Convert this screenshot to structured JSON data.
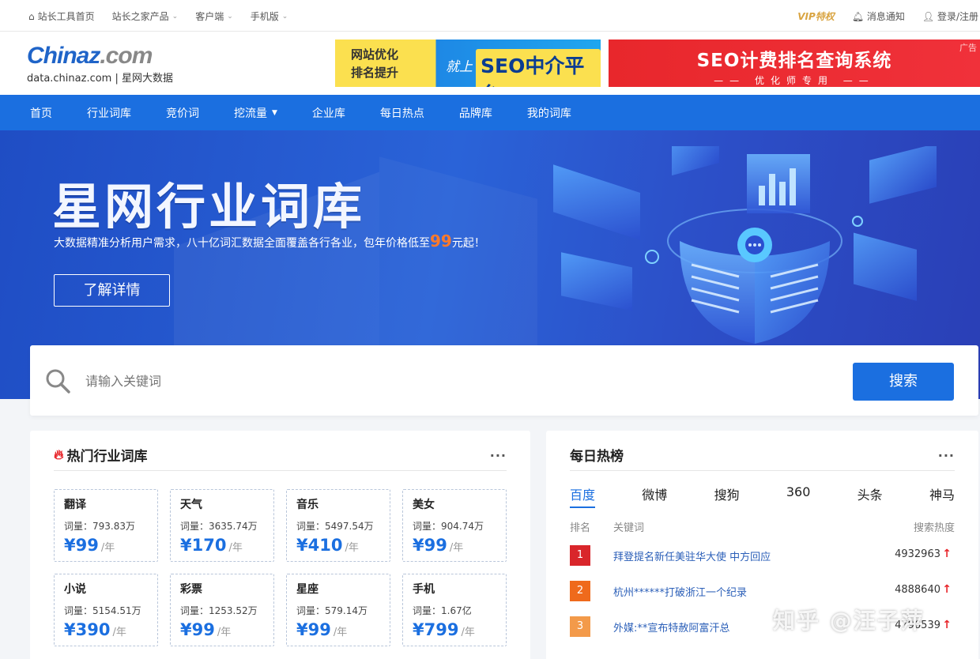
{
  "topbar": {
    "home": "站长工具首页",
    "products": "站长之家产品",
    "client": "客户端",
    "mobile": "手机版",
    "vip": "VIP特权",
    "notice": "消息通知",
    "login": "登录/注册"
  },
  "logo": {
    "brand_a": "Chinaz",
    "brand_b": ".com",
    "domain": "data.chinaz.com",
    "slogan": "星网大数据"
  },
  "ads": {
    "left_line1": "网站优化",
    "left_line2": "排名提升",
    "left_mid": "就上",
    "left_big": "SEO中介平台",
    "right_title": "SEO计费排名查询系统",
    "right_sub": "—— 优化师专用 ——",
    "tag": "广告"
  },
  "nav": {
    "items": [
      "首页",
      "行业词库",
      "竞价词",
      "挖流量",
      "企业库",
      "每日热点",
      "品牌库",
      "我的词库"
    ]
  },
  "hero": {
    "title": "星网行业词库",
    "sub_pre": "大数据精准分析用户需求，八十亿词汇数据全面覆盖各行各业，包年价格低至",
    "sub_num": "99",
    "sub_post": "元起！",
    "button": "了解详情"
  },
  "search": {
    "placeholder": "请输入关键词",
    "button": "搜索"
  },
  "hot": {
    "title": "热门行业词库",
    "more": "···",
    "vol_prefix": "词量：",
    "per_year": "/年",
    "cards": [
      {
        "name": "翻译",
        "vol": "793.83万",
        "price": "¥99"
      },
      {
        "name": "天气",
        "vol": "3635.74万",
        "price": "¥170"
      },
      {
        "name": "音乐",
        "vol": "5497.54万",
        "price": "¥410"
      },
      {
        "name": "美女",
        "vol": "904.74万",
        "price": "¥99"
      },
      {
        "name": "小说",
        "vol": "5154.51万",
        "price": "¥390"
      },
      {
        "name": "彩票",
        "vol": "1253.52万",
        "price": "¥99"
      },
      {
        "name": "星座",
        "vol": "579.14万",
        "price": "¥99"
      },
      {
        "name": "手机",
        "vol": "1.67亿",
        "price": "¥799"
      }
    ]
  },
  "daily": {
    "title": "每日热榜",
    "more": "···",
    "tabs": [
      "百度",
      "微博",
      "搜狗",
      "360",
      "头条",
      "神马"
    ],
    "col_rank": "排名",
    "col_kw": "关键词",
    "col_heat": "搜索热度",
    "rows": [
      {
        "rank": "1",
        "kw": "拜登提名新任美驻华大使 中方回应",
        "heat": "4932963",
        "color": "#d9262b"
      },
      {
        "rank": "2",
        "kw": "杭州******打破浙江一个纪录",
        "heat": "4888640",
        "color": "#ef6a1c"
      },
      {
        "rank": "3",
        "kw": "外媒:**宣布特赦阿富汗总",
        "heat": "4796539",
        "color": "#f39a4a"
      }
    ]
  },
  "watermark": "知乎 @汪子萍",
  "colors": {
    "brand_blue": "#1b6fe0",
    "rank1": "#d9262b",
    "rank2": "#ef6a1c",
    "rank3": "#f39a4a",
    "accent_orange": "#ff7a2b"
  }
}
